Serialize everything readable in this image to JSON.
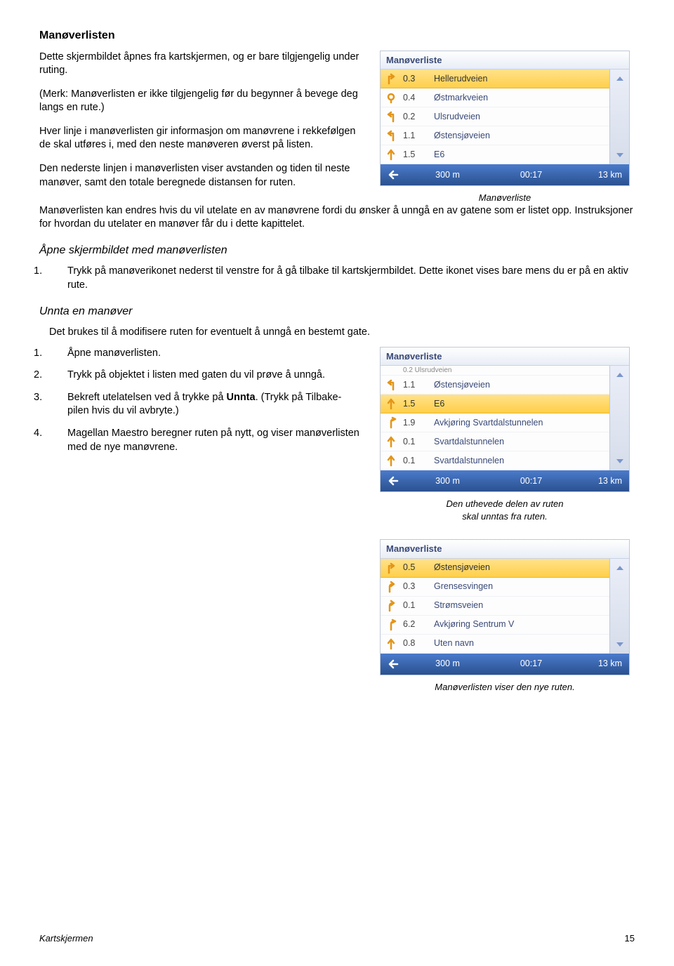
{
  "heading": "Manøverlisten",
  "p1": "Dette skjermbildet åpnes fra kartskjermen, og er bare tilgjengelig under ruting.",
  "p2": "(Merk: Manøverlisten er ikke tilgjengelig før du begynner å bevege deg langs en rute.)",
  "p3": "Hver linje i manøverlisten gir informasjon om manøvrene i rekkefølgen de skal utføres i, med den neste manøveren øverst på listen.",
  "p4": "Den nederste linjen i manøverlisten viser avstanden og tiden til neste manøver, samt den totale beregnede distansen for ruten.",
  "p5a": "Manøverlisten kan endres hvis du vil utelate en av manøvrene fordi du ønsker å unngå en av gatene som er listet opp. Instruksjoner for hvordan du utelater en manøver får du i dette kapittelet.",
  "fig1_cap": "Manøverliste",
  "h2a": "Åpne skjermbildet med manøverlisten",
  "step1": "Trykk på manøverikonet nederst til venstre for å gå tilbake til kartskjermbildet. Dette ikonet vises bare mens du er på en aktiv rute.",
  "h2b": "Unnta en manøver",
  "h2b_desc": "Det brukes til å modifisere ruten for eventuelt å unngå en bestemt gate.",
  "s1": "Åpne manøverlisten.",
  "s2": "Trykk på objektet i listen med gaten du vil prøve å unngå.",
  "s3a": "Bekreft utelatelsen ved å trykke på ",
  "s3b": "Unnta",
  "s3c": ". (Trykk på Tilbake-pilen hvis du vil avbryte.)",
  "s4": "Magellan Maestro beregner ruten på nytt, og viser manøverlisten med de nye manøvrene.",
  "fig2_cap1": "Den uthevede delen av ruten",
  "fig2_cap2": "skal unntas fra ruten.",
  "fig3_cap": "Manøverlisten viser den nye ruten.",
  "footer_left": "Kartskjermen",
  "footer_right": "15",
  "fig1": {
    "title": "Manøverliste",
    "rows": [
      {
        "icon": "right",
        "dist": "0.3",
        "name": "Hellerudveien",
        "hl": true
      },
      {
        "icon": "round",
        "dist": "0.4",
        "name": "Østmarkveien"
      },
      {
        "icon": "left",
        "dist": "0.2",
        "name": "Ulsrudveien"
      },
      {
        "icon": "left",
        "dist": "1.1",
        "name": "Østensjøveien"
      },
      {
        "icon": "up",
        "dist": "1.5",
        "name": "E6"
      }
    ],
    "status": {
      "d": "300 m",
      "t": "00:17",
      "r": "13 km"
    }
  },
  "fig2": {
    "title": "Manøverliste",
    "trunc_label": "0.2   Ulsrudveien",
    "rows": [
      {
        "icon": "left",
        "dist": "1.1",
        "name": "Østensjøveien"
      },
      {
        "icon": "up",
        "dist": "1.5",
        "name": "E6",
        "hl": true
      },
      {
        "icon": "merge",
        "dist": "1.9",
        "name": "Avkjøring Svartdalstunnelen"
      },
      {
        "icon": "up",
        "dist": "0.1",
        "name": "Svartdalstunnelen"
      },
      {
        "icon": "up",
        "dist": "0.1",
        "name": "Svartdalstunnelen"
      }
    ],
    "status": {
      "d": "300 m",
      "t": "00:17",
      "r": "13 km"
    }
  },
  "fig3": {
    "title": "Manøverliste",
    "rows": [
      {
        "icon": "right",
        "dist": "0.5",
        "name": "Østensjøveien",
        "hl": true
      },
      {
        "icon": "sright",
        "dist": "0.3",
        "name": "Grensesvingen"
      },
      {
        "icon": "sright",
        "dist": "0.1",
        "name": "Strømsveien"
      },
      {
        "icon": "merge",
        "dist": "6.2",
        "name": "Avkjøring Sentrum V"
      },
      {
        "icon": "up",
        "dist": "0.8",
        "name": "Uten navn"
      }
    ],
    "status": {
      "d": "300 m",
      "t": "00:17",
      "r": "13 km"
    }
  }
}
